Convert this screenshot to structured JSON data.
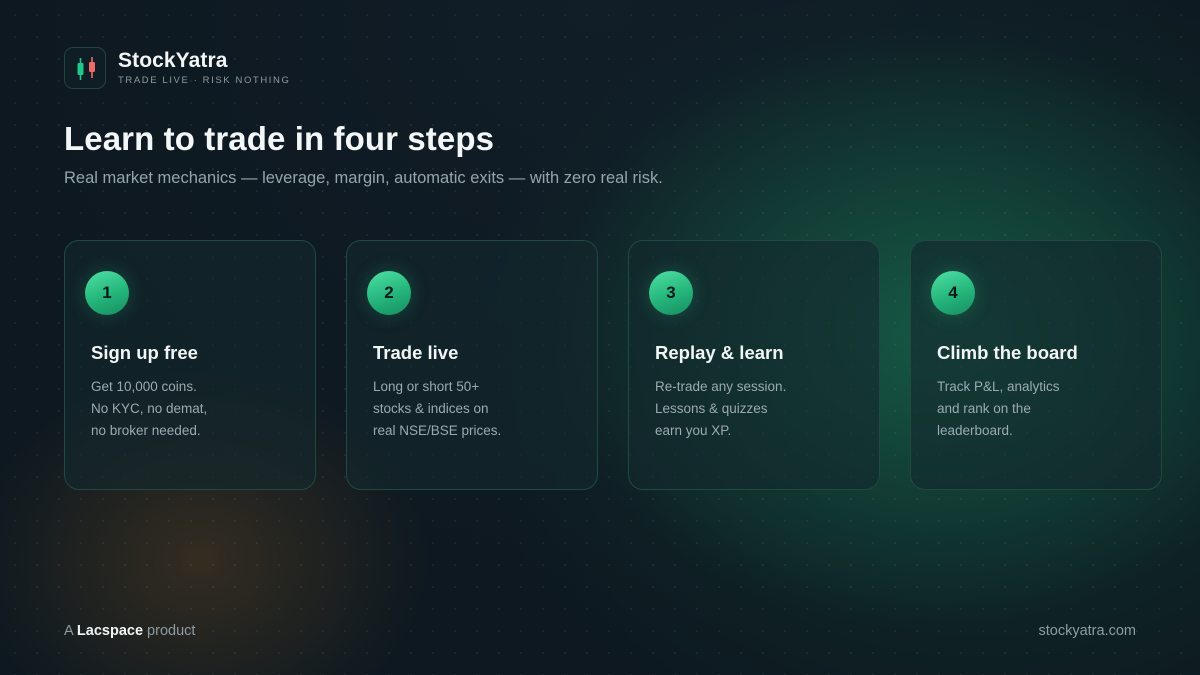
{
  "brand": {
    "name": "StockYatra",
    "tagline": "TRADE LIVE · RISK NOTHING",
    "logo_icon": "candlestick-icon",
    "colors": {
      "bull": "#22c98a",
      "bear": "#f06a6a"
    }
  },
  "hero": {
    "title": "Learn to trade in four steps",
    "subtitle": "Real market mechanics — leverage, margin, automatic exits — with zero real risk."
  },
  "steps": [
    {
      "number": "1",
      "title": "Sign up free",
      "lines": [
        "Get 10,000 coins.",
        "No KYC, no demat,",
        "no broker needed."
      ]
    },
    {
      "number": "2",
      "title": "Trade live",
      "lines": [
        "Long or short 50+",
        "stocks & indices on",
        "real NSE/BSE prices."
      ]
    },
    {
      "number": "3",
      "title": "Replay & learn",
      "lines": [
        "Re-trade any session.",
        "Lessons & quizzes",
        "earn you XP."
      ]
    },
    {
      "number": "4",
      "title": "Climb the board",
      "lines": [
        "Track P&L, analytics",
        "and rank on the",
        "leaderboard."
      ]
    }
  ],
  "footer": {
    "prefix": "A",
    "company": "Lacspace",
    "suffix": "product",
    "url": "stockyatra.com"
  },
  "theme": {
    "accent": "#2ec98c",
    "background": "#0d1820"
  }
}
